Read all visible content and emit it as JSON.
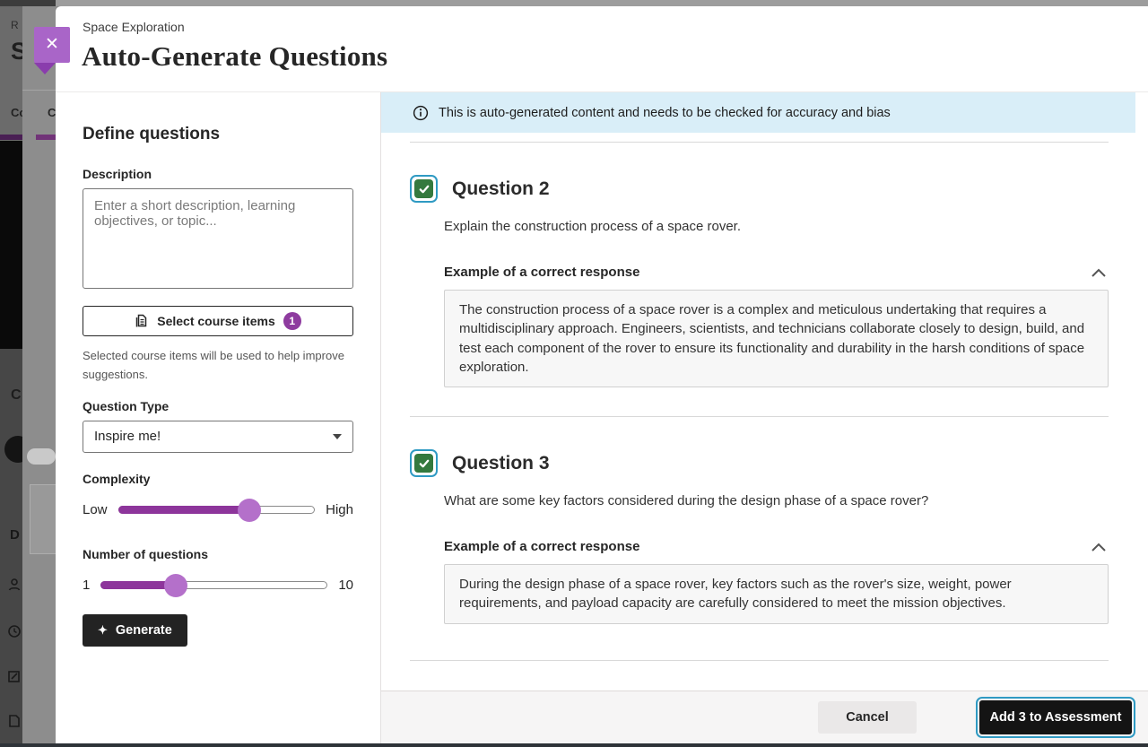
{
  "underlay": {
    "breadcrumb_fragment": "R",
    "page_title_fragment": "S",
    "tab_fragment_left": "Co",
    "tab_fragment_right": "C",
    "section_fragment_1": "C",
    "section_fragment_2": "D"
  },
  "modal": {
    "eyebrow": "Space Exploration",
    "title": "Auto-Generate Questions",
    "close_icon": "✕"
  },
  "panel": {
    "heading": "Define questions",
    "description_label": "Description",
    "description_placeholder": "Enter a short description, learning objectives, or topic...",
    "description_value": "",
    "select_course_items_label": "Select course items",
    "selected_count_badge": "1",
    "helper_text": "Selected course items will be used to help improve suggestions.",
    "question_type_label": "Question Type",
    "question_type_value": "Inspire me!",
    "complexity_label": "Complexity",
    "complexity_low": "Low",
    "complexity_high": "High",
    "complexity_percent": 67,
    "num_questions_label": "Number of questions",
    "num_questions_min": "1",
    "num_questions_max": "10",
    "num_questions_percent": 33,
    "generate_label": "Generate",
    "sparkle_icon": "✦"
  },
  "content": {
    "banner_text": "This is auto-generated content and needs to be checked for accuracy and bias",
    "questions": [
      {
        "title": "Question 2",
        "checked": true,
        "text": "Explain the construction process of a space rover.",
        "example_label": "Example of a correct response",
        "example_text": "The construction process of a space rover is a complex and meticulous undertaking that requires a multidisciplinary approach. Engineers, scientists, and technicians collaborate closely to design, build, and test each component of the rover to ensure its functionality and durability in the harsh conditions of space exploration."
      },
      {
        "title": "Question 3",
        "checked": true,
        "text": "What are some key factors considered during the design phase of a space rover?",
        "example_label": "Example of a correct response",
        "example_text": "During the design phase of a space rover, key factors such as the rover's size, weight, power requirements, and payload capacity are carefully considered to meet the mission objectives."
      }
    ]
  },
  "footer": {
    "cancel_label": "Cancel",
    "add_label": "Add 3 to Assessment"
  },
  "colors": {
    "brand_purple": "#8e3b9f",
    "slider_thumb_purple": "#b470ca",
    "close_button_purple": "#a965c8",
    "banner_blue": "#d9eef8",
    "checkbox_green": "#34793e",
    "focus_ring_teal": "#2f9ac3",
    "primary_button_black": "#141414"
  }
}
